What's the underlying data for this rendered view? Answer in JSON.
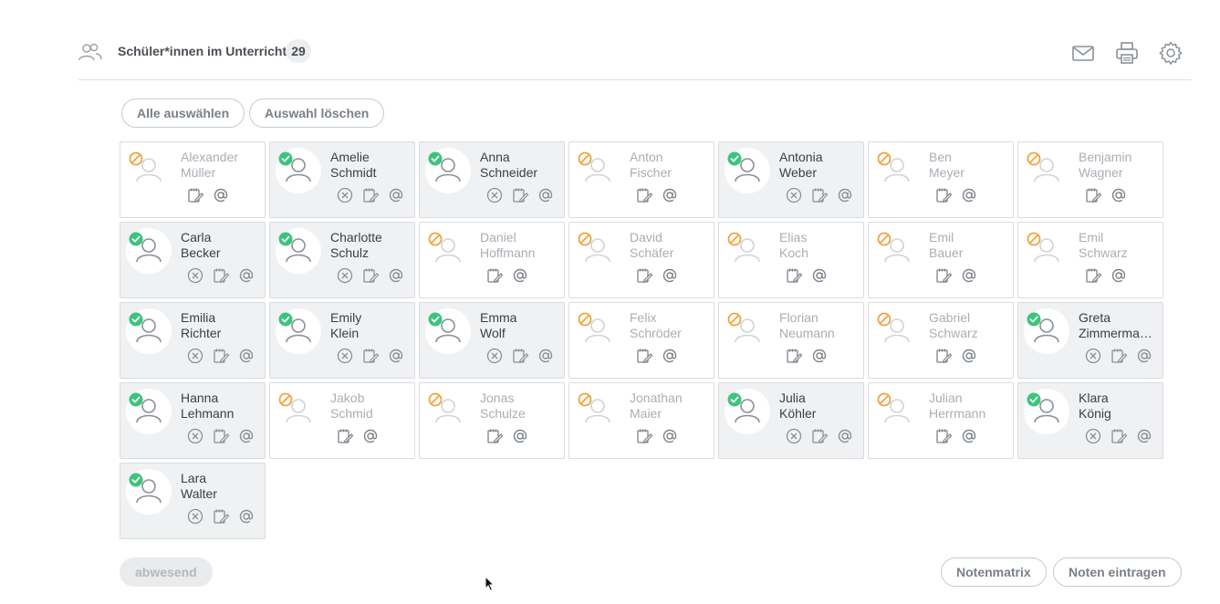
{
  "header": {
    "title": "Schüler*innen im Unterricht",
    "count": "29",
    "icons": [
      "group-icon",
      "mail-icon",
      "printer-icon",
      "gear-icon"
    ]
  },
  "selection": {
    "select_all_label": "Alle auswählen",
    "clear_label": "Auswahl löschen"
  },
  "footer": {
    "absent_label": "abwesend",
    "matrix_label": "Notenmatrix",
    "enter_grades_label": "Noten eintragen"
  },
  "colors": {
    "present": "#3cc47c",
    "absent": "#f2a23c",
    "card_present_bg": "#f0f1f3"
  },
  "students": [
    {
      "first": "Alexander",
      "last": "Müller",
      "present": false
    },
    {
      "first": "Amelie",
      "last": "Schmidt",
      "present": true
    },
    {
      "first": "Anna",
      "last": "Schneider",
      "present": true
    },
    {
      "first": "Anton",
      "last": "Fischer",
      "present": false
    },
    {
      "first": "Antonia",
      "last": "Weber",
      "present": true
    },
    {
      "first": "Ben",
      "last": "Meyer",
      "present": false
    },
    {
      "first": "Benjamin",
      "last": "Wagner",
      "present": false
    },
    {
      "first": "Carla",
      "last": "Becker",
      "present": true
    },
    {
      "first": "Charlotte",
      "last": "Schulz",
      "present": true
    },
    {
      "first": "Daniel",
      "last": "Hoffmann",
      "present": false
    },
    {
      "first": "David",
      "last": "Schäfer",
      "present": false
    },
    {
      "first": "Elias",
      "last": "Koch",
      "present": false
    },
    {
      "first": "Emil",
      "last": "Bauer",
      "present": false
    },
    {
      "first": "Emil",
      "last": "Schwarz",
      "present": false
    },
    {
      "first": "Emilia",
      "last": "Richter",
      "present": true
    },
    {
      "first": "Emily",
      "last": "Klein",
      "present": true
    },
    {
      "first": "Emma",
      "last": "Wolf",
      "present": true
    },
    {
      "first": "Felix",
      "last": "Schröder",
      "present": false
    },
    {
      "first": "Florian",
      "last": "Neumann",
      "present": false
    },
    {
      "first": "Gabriel",
      "last": "Schwarz",
      "present": false
    },
    {
      "first": "Greta",
      "last": "Zimmerma…",
      "present": true
    },
    {
      "first": "Hanna",
      "last": "Lehmann",
      "present": true
    },
    {
      "first": "Jakob",
      "last": "Schmid",
      "present": false
    },
    {
      "first": "Jonas",
      "last": "Schulze",
      "present": false
    },
    {
      "first": "Jonathan",
      "last": "Maier",
      "present": false
    },
    {
      "first": "Julia",
      "last": "Köhler",
      "present": true
    },
    {
      "first": "Julian",
      "last": "Herrmann",
      "present": false
    },
    {
      "first": "Klara",
      "last": "König",
      "present": true
    },
    {
      "first": "Lara",
      "last": "Walter",
      "present": true
    }
  ]
}
